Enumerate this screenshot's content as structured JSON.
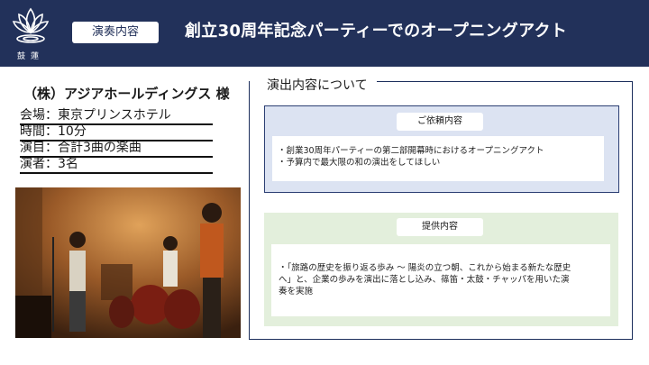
{
  "brand": {
    "logo_text": "鼓蓮"
  },
  "header": {
    "tag": "演奏内容",
    "title": "創立30周年記念パーティーでのオープニングアクト"
  },
  "client": "（株）アジアホールディングス 様",
  "details": [
    "会場：東京プリンスホテル",
    "時間：10分",
    "演目：合計3曲の楽曲",
    "演者：3名"
  ],
  "panel": {
    "title": "演出内容について",
    "request": {
      "label": "ご依頼内容",
      "lines": [
        "・創業30周年パーティーの第二部開幕時におけるオープニングアクト",
        "・予算内で最大限の和の演出をしてほしい"
      ]
    },
    "offer": {
      "label": "提供内容",
      "lines": [
        "・「旅路の歴史を振り返る歩み 〜 陽炎の立つ朝、これから始まる新たな歴史",
        "へ」と、企業の歩みを演出に落とし込み、篠笛・太鼓・チャッパを用いた演",
        "奏を実施"
      ]
    }
  },
  "colors": {
    "header": "#22315a",
    "request_bg": "#dce3f2",
    "offer_bg": "#e3efdc"
  }
}
